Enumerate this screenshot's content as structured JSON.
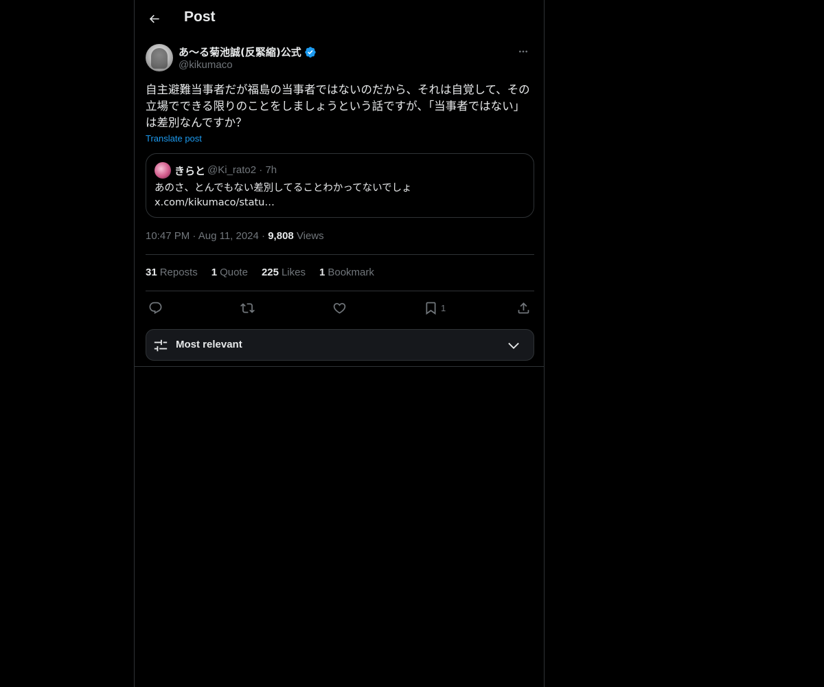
{
  "header": {
    "title": "Post"
  },
  "post": {
    "author": {
      "display_name": "あ〜る菊池誠(反緊縮)公式",
      "handle": "@kikumaco",
      "verified": true
    },
    "text": "自主避難当事者だが福島の当事者ではないのだから、それは自覚して、その立場でできる限りのことをしましょうという話ですが、「当事者ではない」は差別なんですか？",
    "translate_label": "Translate post",
    "quoted": {
      "display_name": "きらと",
      "handle": "@Ki_rato2",
      "separator": "·",
      "age": "7h",
      "text_line1": "あのさ、とんでもない差別してることわかってないでしょ",
      "text_line2": "x.com/kikumaco/statu…"
    },
    "time": "10:47 PM",
    "dot": "·",
    "date": "Aug 11, 2024",
    "views_count": "9,808",
    "views_label": "Views",
    "stats": {
      "reposts_count": "31",
      "reposts_label": "Reposts",
      "quotes_count": "1",
      "quotes_label": "Quote",
      "likes_count": "225",
      "likes_label": "Likes",
      "bookmarks_count": "1",
      "bookmarks_label": "Bookmark"
    },
    "actions": {
      "reply": "reply-icon",
      "repost": "repost-icon",
      "like": "heart-icon",
      "bookmark": "bookmark-icon",
      "bookmark_count": "1",
      "share": "share-icon"
    }
  },
  "replies_sort": {
    "label": "Most relevant"
  },
  "colors": {
    "background": "#000000",
    "text": "#e7e9ea",
    "muted": "#71767b",
    "accent": "#1d9bf0",
    "border": "#2f3336"
  }
}
